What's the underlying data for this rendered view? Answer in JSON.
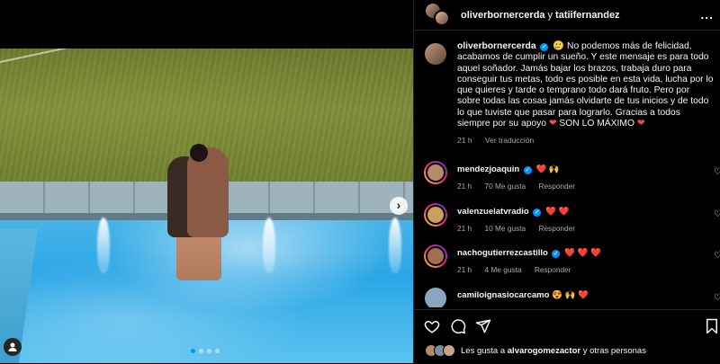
{
  "header": {
    "user1": "oliverbornercerda",
    "conj": "y",
    "user2": "tatiifernandez",
    "more": "..."
  },
  "caption": {
    "user": "oliverbornercerda",
    "emoji": "🥲",
    "text": "No podemos más de felicidad, acabamos de cumplir un sueño. Y este mensaje es para todo aquel soñador. Jamás bajar los brazos, trabaja duro para conseguir tus metas, todo es posible en esta vida, lucha por lo que quieres y tarde o temprano todo dará fruto. Pero por sobre todas las cosas jamás olvidarte de tus inicios y de todo lo que tuviste que pasar para lograrlo. Gracias a todos siempre por su apoyo",
    "heart1": "❤",
    "tail": "SON LO MÁXIMO",
    "heart2": "❤",
    "time": "21 h",
    "translate": "Ver traducción"
  },
  "comments": [
    {
      "user": "mendezjoaquin",
      "verified": true,
      "text": "❤️ 🙌",
      "time": "21 h",
      "likes": "70 Me gusta",
      "reply": "Responder",
      "avatar_color": "#b98a6a"
    },
    {
      "user": "valenzuelatvradio",
      "verified": true,
      "text": "❤️ ❤️",
      "time": "21 h",
      "likes": "10 Me gusta",
      "reply": "Responder",
      "avatar_color": "#c9a15a"
    },
    {
      "user": "nachogutierrezcastillo",
      "verified": true,
      "text": "❤️ ❤️ ❤️",
      "time": "21 h",
      "likes": "4 Me gusta",
      "reply": "Responder",
      "avatar_color": "#a07050"
    },
    {
      "user": "camiloignasiocarcamo",
      "verified": false,
      "text": "😍 🙌 ❤️",
      "time": "",
      "likes": "",
      "reply": "",
      "avatar_color": "#8aa6c0"
    }
  ],
  "likes_line": {
    "prefix": "Les gusta a",
    "user": "alvarogomezactor",
    "suffix": "y otras personas"
  },
  "photo": {
    "next": "›"
  },
  "colors": {
    "accent": "#0095f6",
    "heart": "#ed4956"
  }
}
